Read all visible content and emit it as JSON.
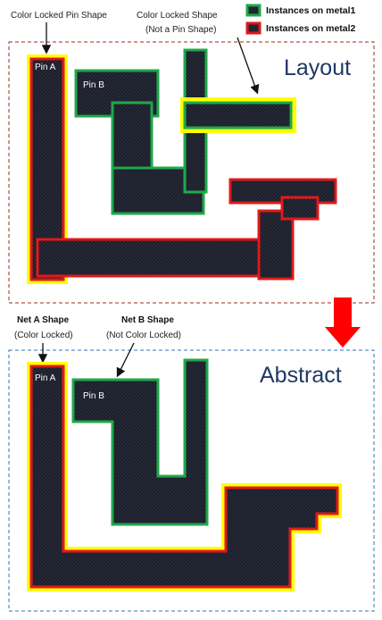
{
  "legend": {
    "metal1": {
      "label": "Instances on metal1",
      "color": "#1fa84a"
    },
    "metal2": {
      "label": "Instances on metal2",
      "color": "#e0191b"
    }
  },
  "colors": {
    "yellow_lock": "#ffff00",
    "shape_fill": "#1c1f2b",
    "layout_border": "#9b2c22",
    "abstract_border": "#2e75b6",
    "arrow_red": "#ff0000",
    "title_blue": "#1f3864"
  },
  "layout": {
    "title": "Layout",
    "annotation_pin": "Color Locked Pin Shape",
    "annotation_shape_line1": "Color Locked Shape",
    "annotation_shape_line2": "(Not a Pin Shape)",
    "pin_a": "Pin A",
    "pin_b": "Pin B"
  },
  "abstract": {
    "title": "Abstract",
    "net_a_line1": "Net A Shape",
    "net_a_line2": "(Color Locked)",
    "net_b_line1": "Net B Shape",
    "net_b_line2": "(Not Color Locked)",
    "pin_a": "Pin A",
    "pin_b": "Pin B"
  }
}
